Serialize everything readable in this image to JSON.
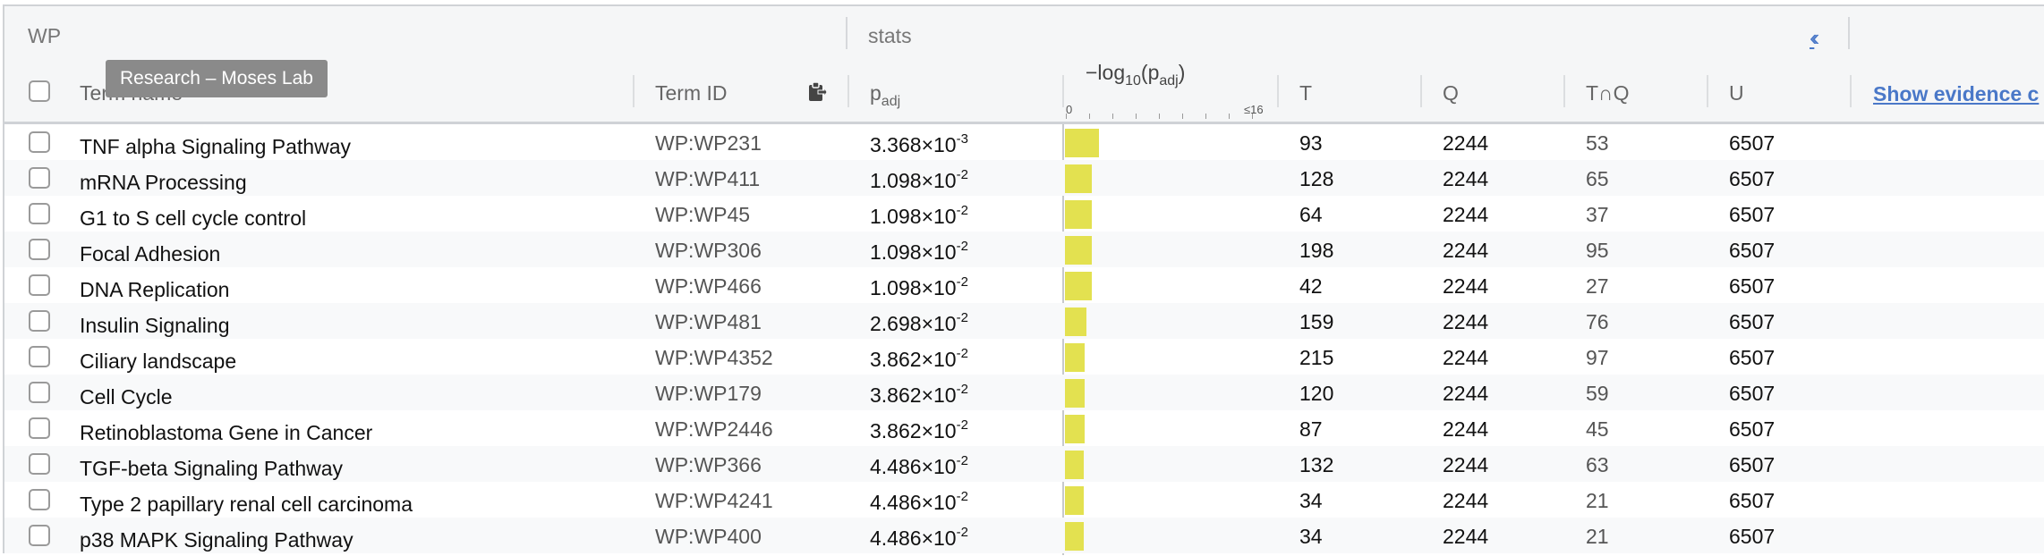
{
  "groups": {
    "source": "WP",
    "stats": "stats",
    "collapse_icon": "double-chevron-left-icon"
  },
  "columns": {
    "term_name": "Term name",
    "term_id": "Term ID",
    "padj_main": "p",
    "padj_sub": "adj",
    "log_prefix": "−log",
    "log_sub": "10",
    "log_mid": "(p",
    "log_sub2": "adj",
    "log_end": ")",
    "scale_min": "0",
    "scale_max": "≤16",
    "t": "T",
    "q": "Q",
    "tq": "T∩Q",
    "u": "U",
    "show_evidence": "Show evidence c"
  },
  "tooltip": "Research – Moses Lab",
  "colors": {
    "bar": "#e3e150",
    "link": "#4a78c8"
  },
  "rows": [
    {
      "name": "TNF alpha Signaling Pathway",
      "id": "WP:WP231",
      "mant": "3.368",
      "exp": "-3",
      "t": "93",
      "q": "2244",
      "tq": "53",
      "u": "6507",
      "neglog": 2.47
    },
    {
      "name": "mRNA Processing",
      "id": "WP:WP411",
      "mant": "1.098",
      "exp": "-2",
      "t": "128",
      "q": "2244",
      "tq": "65",
      "u": "6507",
      "neglog": 1.96
    },
    {
      "name": "G1 to S cell cycle control",
      "id": "WP:WP45",
      "mant": "1.098",
      "exp": "-2",
      "t": "64",
      "q": "2244",
      "tq": "37",
      "u": "6507",
      "neglog": 1.96
    },
    {
      "name": "Focal Adhesion",
      "id": "WP:WP306",
      "mant": "1.098",
      "exp": "-2",
      "t": "198",
      "q": "2244",
      "tq": "95",
      "u": "6507",
      "neglog": 1.96
    },
    {
      "name": "DNA Replication",
      "id": "WP:WP466",
      "mant": "1.098",
      "exp": "-2",
      "t": "42",
      "q": "2244",
      "tq": "27",
      "u": "6507",
      "neglog": 1.96
    },
    {
      "name": "Insulin Signaling",
      "id": "WP:WP481",
      "mant": "2.698",
      "exp": "-2",
      "t": "159",
      "q": "2244",
      "tq": "76",
      "u": "6507",
      "neglog": 1.57
    },
    {
      "name": "Ciliary landscape",
      "id": "WP:WP4352",
      "mant": "3.862",
      "exp": "-2",
      "t": "215",
      "q": "2244",
      "tq": "97",
      "u": "6507",
      "neglog": 1.41
    },
    {
      "name": "Cell Cycle",
      "id": "WP:WP179",
      "mant": "3.862",
      "exp": "-2",
      "t": "120",
      "q": "2244",
      "tq": "59",
      "u": "6507",
      "neglog": 1.41
    },
    {
      "name": "Retinoblastoma Gene in Cancer",
      "id": "WP:WP2446",
      "mant": "3.862",
      "exp": "-2",
      "t": "87",
      "q": "2244",
      "tq": "45",
      "u": "6507",
      "neglog": 1.41
    },
    {
      "name": "TGF-beta Signaling Pathway",
      "id": "WP:WP366",
      "mant": "4.486",
      "exp": "-2",
      "t": "132",
      "q": "2244",
      "tq": "63",
      "u": "6507",
      "neglog": 1.35
    },
    {
      "name": "Type 2 papillary renal cell carcinoma",
      "id": "WP:WP4241",
      "mant": "4.486",
      "exp": "-2",
      "t": "34",
      "q": "2244",
      "tq": "21",
      "u": "6507",
      "neglog": 1.35
    },
    {
      "name": "p38 MAPK Signaling Pathway",
      "id": "WP:WP400",
      "mant": "4.486",
      "exp": "-2",
      "t": "34",
      "q": "2244",
      "tq": "21",
      "u": "6507",
      "neglog": 1.35
    }
  ]
}
